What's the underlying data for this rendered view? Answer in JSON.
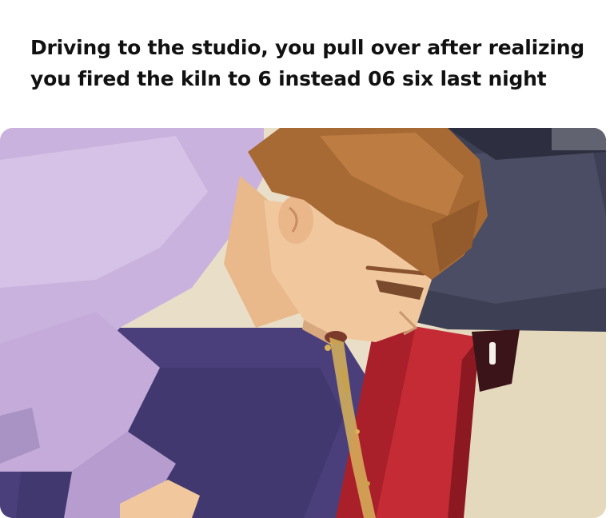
{
  "meme": {
    "caption_lines": [
      "Driving to the studio, you pull over after realizing",
      "you fired the kiln to 6 instead 06 six last night"
    ]
  },
  "illustration": {
    "icon": "man-vomiting-beside-car-illustration",
    "colors": {
      "shirt": "#c9b2dd",
      "hair": "#a86a35",
      "skin": "#f1c79d",
      "car": "#c42b35",
      "tire": "#3a3d52",
      "ground": "#e6dcc4",
      "vomit": "#d8b35a"
    }
  }
}
